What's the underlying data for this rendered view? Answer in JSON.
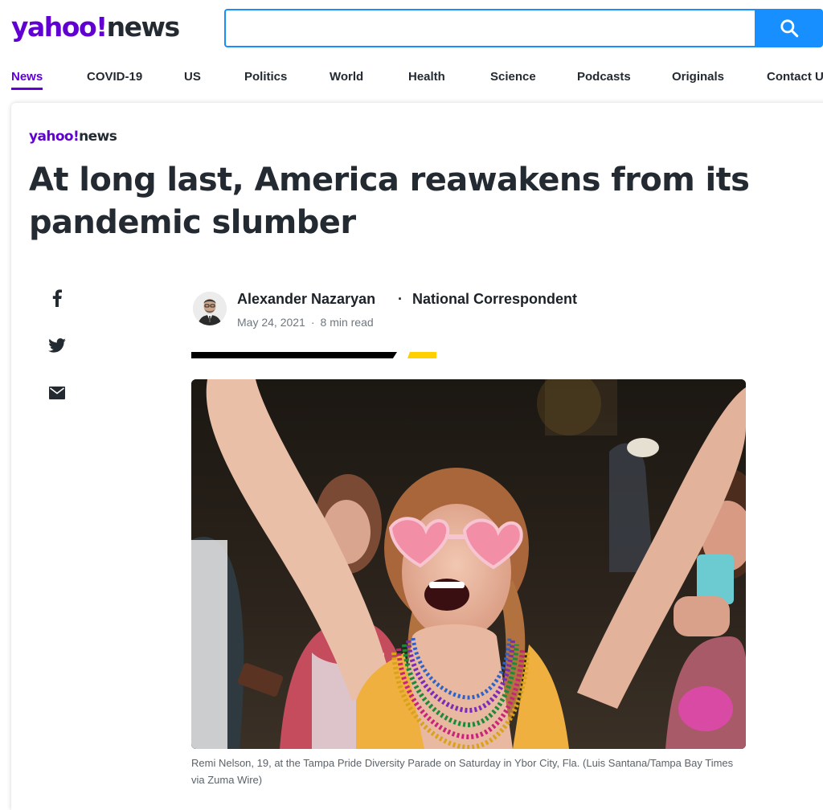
{
  "header": {
    "logo_brand": "yahoo!",
    "logo_section": "news",
    "search_value": "",
    "search_placeholder": ""
  },
  "nav": {
    "items": [
      "News",
      "COVID-19",
      "US",
      "Politics",
      "World",
      "Health",
      "Science",
      "Podcasts",
      "Originals",
      "Contact U"
    ],
    "active_index": 0
  },
  "article": {
    "source_brand": "yahoo!",
    "source_section": "news",
    "headline": "At long last, America reawakens from its pandemic slumber",
    "author": "Alexander Nazaryan",
    "author_title": "National Correspondent",
    "date": "May 24, 2021",
    "read_time": "8 min read",
    "caption": "Remi Nelson, 19, at the Tampa Pride Diversity Parade on Saturday in Ybor City, Fla. (Luis Santana/Tampa Bay Times via Zuma Wire)"
  },
  "share": [
    "facebook-icon",
    "twitter-icon",
    "mail-icon"
  ],
  "colors": {
    "brand_purple": "#6001d2",
    "search_blue": "#188fff",
    "text_dark": "#232a31",
    "accent_yellow": "#ffd000"
  }
}
